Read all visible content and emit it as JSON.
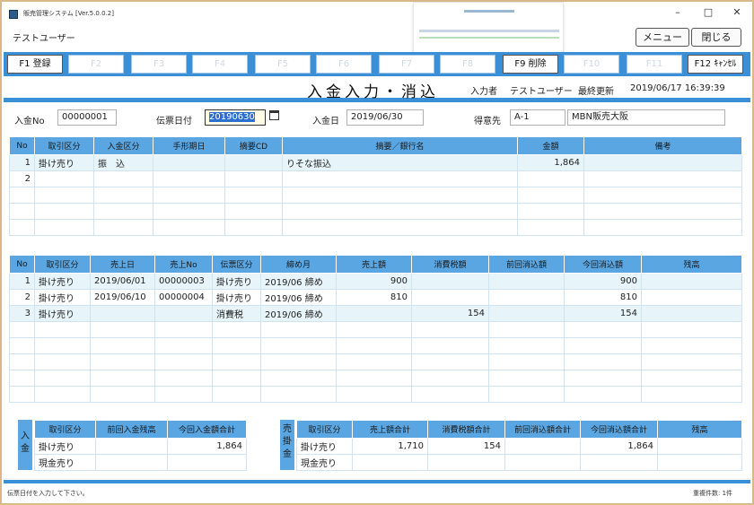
{
  "window": {
    "title": "販売管理システム [Ver.5.0.0.2]",
    "user": "テストユーザー",
    "minimize": "–",
    "maximize": "□",
    "close": "✕"
  },
  "toolbar": {
    "menu_label": "メニュー",
    "close_label": "閉じる"
  },
  "fkeys": [
    {
      "label": "F1 登録",
      "enabled": true
    },
    {
      "label": "F2",
      "enabled": false
    },
    {
      "label": "F3",
      "enabled": false
    },
    {
      "label": "F4",
      "enabled": false
    },
    {
      "label": "F5",
      "enabled": false
    },
    {
      "label": "F6",
      "enabled": false
    },
    {
      "label": "F7",
      "enabled": false
    },
    {
      "label": "F8",
      "enabled": false
    },
    {
      "label": "F9 削除",
      "enabled": true
    },
    {
      "label": "F10",
      "enabled": false
    },
    {
      "label": "F11",
      "enabled": false
    },
    {
      "label": "F12 ｷｬﾝｾﾙ",
      "enabled": true
    }
  ],
  "header": {
    "screen_title": "入金入力・消込",
    "entered_by_label": "入力者",
    "entered_by": "テストユーザー",
    "last_update_label": "最終更新",
    "last_update": "2019/06/17 16:39:39"
  },
  "form": {
    "payment_no_label": "入金No",
    "payment_no": "00000001",
    "slip_date_label": "伝票日付",
    "slip_date": "20190630",
    "payment_date_label": "入金日",
    "payment_date": "2019/06/30",
    "customer_label": "得意先",
    "customer_code": "A-1",
    "customer_name": "MBN販売大阪"
  },
  "payment_table": {
    "headers": [
      "No",
      "取引区分",
      "入金区分",
      "手形期日",
      "摘要CD",
      "摘要／銀行名",
      "金額",
      "備考"
    ],
    "rows": [
      [
        "1",
        "掛け売り",
        "振　込",
        "",
        "",
        "りそな振込",
        "1,864",
        ""
      ],
      [
        "2",
        "",
        "",
        "",
        "",
        "",
        "",
        ""
      ],
      [
        "",
        "",
        "",
        "",
        "",
        "",
        "",
        ""
      ],
      [
        "",
        "",
        "",
        "",
        "",
        "",
        "",
        ""
      ],
      [
        "",
        "",
        "",
        "",
        "",
        "",
        "",
        ""
      ]
    ]
  },
  "sales_table": {
    "headers": [
      "No",
      "取引区分",
      "売上日",
      "売上No",
      "伝票区分",
      "締め月",
      "売上額",
      "消費税額",
      "前回消込額",
      "今回消込額",
      "残高"
    ],
    "rows": [
      [
        "1",
        "掛け売り",
        "2019/06/01",
        "00000003",
        "掛け売り",
        "2019/06 締め",
        "900",
        "",
        "",
        "900",
        ""
      ],
      [
        "2",
        "掛け売り",
        "2019/06/10",
        "00000004",
        "掛け売り",
        "2019/06 締め",
        "810",
        "",
        "",
        "810",
        ""
      ],
      [
        "3",
        "掛け売り",
        "",
        "",
        "消費税",
        "2019/06 締め",
        "",
        "154",
        "",
        "154",
        ""
      ],
      [
        "",
        "",
        "",
        "",
        "",
        "",
        "",
        "",
        "",
        "",
        ""
      ],
      [
        "",
        "",
        "",
        "",
        "",
        "",
        "",
        "",
        "",
        "",
        ""
      ],
      [
        "",
        "",
        "",
        "",
        "",
        "",
        "",
        "",
        "",
        "",
        ""
      ],
      [
        "",
        "",
        "",
        "",
        "",
        "",
        "",
        "",
        "",
        "",
        ""
      ],
      [
        "",
        "",
        "",
        "",
        "",
        "",
        "",
        "",
        "",
        "",
        ""
      ]
    ]
  },
  "payment_summary": {
    "side_label": "入金",
    "headers": [
      "取引区分",
      "前回入金残高",
      "今回入金額合計"
    ],
    "rows": [
      [
        "掛け売り",
        "",
        "1,864"
      ],
      [
        "現金売り",
        "",
        ""
      ]
    ]
  },
  "sales_summary": {
    "side_label": "売掛金",
    "headers": [
      "取引区分",
      "売上額合計",
      "消費税額合計",
      "前回消込額合計",
      "今回消込額合計",
      "残高"
    ],
    "rows": [
      [
        "掛け売り",
        "1,710",
        "154",
        "",
        "1,864",
        ""
      ],
      [
        "現金売り",
        "",
        "",
        "",
        "",
        ""
      ]
    ]
  },
  "status": {
    "message": "伝票日付を入力して下さい。",
    "right": "重複件数: 1件"
  }
}
